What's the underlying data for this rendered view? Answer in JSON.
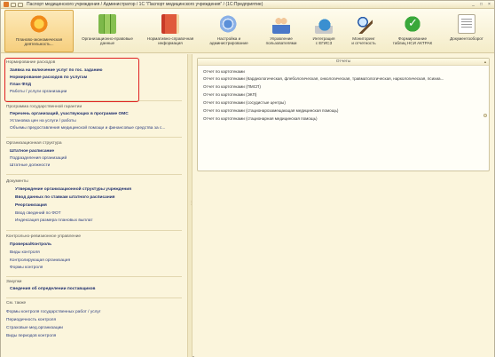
{
  "titlebar": {
    "title": "Паспорт медицинского учреждения / Администратор / 1С \"Паспорт медицинского учреждения\" / (1С:Предприятие)",
    "min": "_",
    "max": "□",
    "close": "×"
  },
  "toolbar": {
    "items": [
      {
        "label": "Планово-экономическая\nдеятельность...",
        "icon": "star-icon"
      },
      {
        "label": "Организационно-правовые\nданные",
        "icon": "books-icon"
      },
      {
        "label": "Нормативно-справочная\nинформация",
        "icon": "red-book-icon"
      },
      {
        "label": "Настройка и\nадминистрирование",
        "icon": "settings-icon"
      },
      {
        "label": "Управление\nпользователями",
        "icon": "users-icon"
      },
      {
        "label": "Интеграция\nс ЕГИСЗ",
        "icon": "globe-icon"
      },
      {
        "label": "Мониторинг\nи отчетность",
        "icon": "search-icon"
      },
      {
        "label": "Формирование\nтаблиц НСИ АКТРАК",
        "icon": "check-icon"
      },
      {
        "label": "Документооборот",
        "icon": "document-icon"
      }
    ]
  },
  "left": {
    "sections": [
      {
        "header": "Нормирование расходов",
        "links": [
          {
            "text": "Заявка на включение услуг по гос. заданию",
            "bold": true
          },
          {
            "text": "Нормирование расходов по услугам",
            "bold": true
          },
          {
            "text": "План ФХД",
            "bold": true
          },
          {
            "text": "Работы / услуги организации",
            "bold": false
          }
        ]
      },
      {
        "header": "Программа государственной гарантии",
        "links": [
          {
            "text": "Перечень организаций, участвующих в программе ОМС",
            "bold": true
          },
          {
            "text": "Установка цен на услуги / работы",
            "bold": false
          },
          {
            "text": "Объемы предоставления медицинской помощи и финансовые средства за с...",
            "bold": false
          }
        ]
      },
      {
        "header": "Организационная структура",
        "links": [
          {
            "text": "Штатное расписание",
            "bold": true
          },
          {
            "text": "Подразделения организаций",
            "bold": false
          },
          {
            "text": "Штатные должности",
            "bold": false
          }
        ]
      },
      {
        "header": "Документы",
        "links": [
          {
            "text": "Утверждение организационной структуры учреждения",
            "bold": true
          },
          {
            "text": "Ввод данных по ставкам штатного расписания",
            "bold": true
          },
          {
            "text": "Реорганизация",
            "bold": true
          },
          {
            "text": "Ввод сведений по ФОТ",
            "bold": false
          },
          {
            "text": "Индексация размера плановых выплат",
            "bold": false
          }
        ]
      },
      {
        "header": "Контрольно-ревизионное управление",
        "links": [
          {
            "text": "Проверка/Контроль",
            "bold": true
          },
          {
            "text": "Виды контроля",
            "bold": false
          },
          {
            "text": "Контролирующая организация",
            "bold": false
          },
          {
            "text": "Формы контроля",
            "bold": false
          }
        ]
      },
      {
        "header": "Закупки",
        "links": [
          {
            "text": "Сведения об определении поставщиков",
            "bold": true
          }
        ]
      },
      {
        "header": "См. также",
        "links": [
          {
            "text": "Формы контроля государственных работ / услуг",
            "bold": false
          },
          {
            "text": "Периодичность контроля",
            "bold": false
          },
          {
            "text": "Страховые мед.организации",
            "bold": false
          },
          {
            "text": "Виды периодов контроля",
            "bold": false
          }
        ]
      }
    ]
  },
  "splitter": {
    "grip": "⋮"
  },
  "reports": {
    "title": "Отчеты",
    "items": [
      "Отчет по картотеками",
      "Отчет по картотеками (Кардиологическая, флебологическая, онкологическая, травматологическая, наркологическая, психиа...",
      "Отчет по картотеками (ПМСП)",
      "Отчет по картотеками (ЭКП)",
      "Отчет по картотеками (сосудистые центры)",
      "Отчет по картотеками (стационарозамещающая медицинская помощь)",
      "Отчет по картотеками (стационарная медицинская помощь)"
    ],
    "scroll_up": "▲",
    "scroll_down": "▼"
  }
}
